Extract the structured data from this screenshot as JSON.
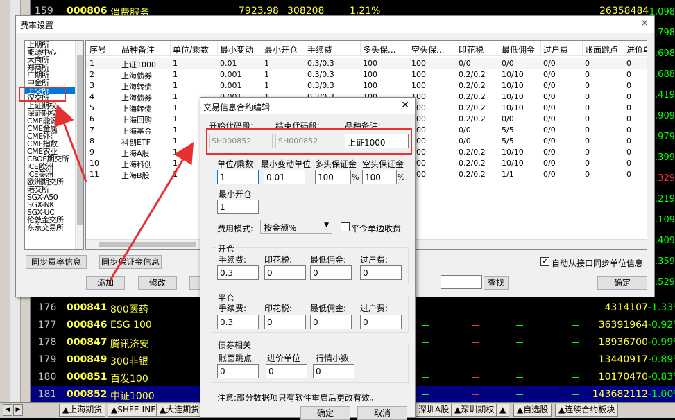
{
  "background_table": {
    "top_row": {
      "no": "159",
      "code": "000806",
      "name": "消费服务",
      "price": "7923.98",
      "vol": "308208",
      "pct": "1.21%",
      "right_vol": "26358484",
      "right_chg": "0.119"
    },
    "right_changes": [
      {
        "value": "1.098",
        "color": "green"
      },
      {
        "value": ".798",
        "color": "green"
      },
      {
        "value": "1.698",
        "color": "green"
      },
      {
        "value": "1.688",
        "color": "green"
      },
      {
        "value": ".419",
        "color": "green"
      },
      {
        "value": "1.909",
        "color": "green"
      },
      {
        "value": ".979",
        "color": "green"
      },
      {
        "value": ".399",
        "color": "green"
      },
      {
        "value": ".329",
        "color": "red"
      },
      {
        "value": ".219",
        "color": "green"
      },
      {
        "value": ".109",
        "color": "green"
      },
      {
        "value": ".409",
        "color": "green"
      },
      {
        "value": ".359",
        "color": "green"
      },
      {
        "value": ".529",
        "color": "green"
      }
    ],
    "rows": [
      {
        "no": "176",
        "code": "000841",
        "name": "800医药",
        "vol": "4314107",
        "chg": "-1.33%"
      },
      {
        "no": "177",
        "code": "000846",
        "name": "ESG 100",
        "vol": "36391964",
        "chg": "-0.92%"
      },
      {
        "no": "178",
        "code": "000847",
        "name": "腾讯济安",
        "vol": "18936700",
        "chg": "-0.99%"
      },
      {
        "no": "179",
        "code": "000849",
        "name": "300非银",
        "vol": "13440917",
        "chg": "-0.89%"
      },
      {
        "no": "180",
        "code": "000851",
        "name": "百发100",
        "vol": "10170470",
        "chg": "-0.83%"
      },
      {
        "no": "181",
        "code": "000852",
        "name": "中证1000",
        "vol": "143682112",
        "chg": "-1.00%"
      }
    ],
    "tabs": [
      "▲上海期货",
      "▲SHFE-INE",
      "▲大连期货",
      "深圳A股",
      "▲深圳期权",
      "▲",
      "▲自选股",
      "▲连续合约板块"
    ]
  },
  "fee_dialog": {
    "title": "费率设置",
    "exchanges": [
      "上期所",
      "能源中心",
      "大商所",
      "郑商所",
      "广期所",
      "中金所",
      "上交所",
      "深交所",
      "上证期权",
      "深证期权",
      "CME能源",
      "CME金属",
      "CME外汇",
      "CME指数",
      "CME农业",
      "CBOE期交所",
      "ICE欧洲",
      "ICE美洲",
      "欧洲期交所",
      "港交所",
      "SGX-A50",
      "SGX-NK",
      "SGX-UC",
      "伦敦金交所",
      "东京交易所"
    ],
    "selected_exchange": "上交所",
    "columns": [
      "序号",
      "品种备注",
      "单位/乘数",
      "最小变动",
      "最小开仓",
      "手续费",
      "多头保...",
      "空头保...",
      "印花税",
      "最低佣金",
      "过户费",
      "账面跳点",
      "进价单"
    ],
    "rows": [
      [
        "1",
        "上证1000",
        "1",
        "0.01",
        "1",
        "0.3/0.3",
        "100",
        "100",
        "0/0",
        "0/0",
        "0/0",
        "0",
        "0"
      ],
      [
        "2",
        "上海债券",
        "1",
        "0.001",
        "1",
        "0.3/0.3",
        "100",
        "100",
        "0.2/0.2",
        "10/10",
        "0/0",
        "0",
        "0"
      ],
      [
        "3",
        "上海转债",
        "1",
        "0.001",
        "1",
        "0.3/0.3",
        "100",
        "100",
        "0.2/0.2",
        "10/10",
        "0/0",
        "0",
        "0"
      ],
      [
        "4",
        "上海债券",
        "1",
        "0.001",
        "1",
        "0.3/0.3",
        "100",
        "100",
        "0.2/0.2",
        "10/10",
        "0/0",
        "0",
        "0"
      ],
      [
        "5",
        "上海转债",
        "1",
        "0.001",
        "1",
        "0.3/0.3",
        "100",
        "100",
        "0.2/0.2",
        "10/10",
        "0/0",
        "0",
        "0"
      ],
      [
        "6",
        "上海回购",
        "1",
        "0.001",
        "1",
        "0.3/0.3",
        "100",
        "100",
        "0.2/0.2",
        "0/0",
        "0/0",
        "0",
        "0"
      ],
      [
        "7",
        "上海基金",
        "1",
        "0.001",
        "1",
        "0.3/0.3",
        "100",
        "100",
        "0/0",
        "5/5",
        "0/0",
        "0",
        "0"
      ],
      [
        "8",
        "科创ETF",
        "1",
        "0.001",
        "1",
        "0.3/0.3",
        "100",
        "100",
        "0/0",
        "5/5",
        "0/0",
        "0",
        "0"
      ],
      [
        "9",
        "上海A股",
        "1",
        "0.01",
        "1",
        "0.3/0.3",
        "100",
        "100",
        "0.2/0.2",
        "10/10",
        "0/0",
        "0",
        "0"
      ],
      [
        "10",
        "上海科创",
        "1",
        "0.01",
        "1",
        "0.3/0.3",
        "100",
        "100",
        "0.2/0.2",
        "10/10",
        "0/0",
        "0",
        "0"
      ],
      [
        "11",
        "上海B股",
        "1",
        "0.001",
        "1",
        "0.3/0.3",
        "100",
        "100",
        "0.2/0.2",
        "1/1",
        "0/0",
        "0",
        "0"
      ]
    ],
    "btn_sync_fee": "同步费率信息",
    "btn_sync_margin": "同步保证金信息",
    "btn_add": "添加",
    "btn_edit": "修改",
    "btn_search": "查找",
    "btn_ok": "确定",
    "auto_sync_label": "自动从接口同步单位信息",
    "auto_sync_checked": true
  },
  "edit_dialog": {
    "title": "交易信息合约编辑",
    "label_start_code": "开始代码段:",
    "label_end_code": "结束代码段:",
    "label_remark": "品种备注:",
    "start_code": "SH000852",
    "end_code": "SH000852",
    "remark": "上证1000",
    "label_unit": "单位/乘数",
    "label_min_tick": "最小变动单位",
    "label_long_margin": "多头保证金",
    "label_short_margin": "空头保证金",
    "unit": "1",
    "min_tick": "0.01",
    "long_margin": "100",
    "short_margin": "100",
    "pct_sign": "%",
    "label_min_open": "最小开仓",
    "min_open": "1",
    "label_fee_mode": "费用模式:",
    "fee_mode": "按金额%",
    "label_close_today": "平今单边收费",
    "open_group": "开仓",
    "close_group": "平仓",
    "bond_group": "债券相关",
    "label_fee": "手续费:",
    "label_stamp": "印花税:",
    "label_min_comm": "最低佣金:",
    "label_transfer": "过户费:",
    "open_fee": "0.3",
    "open_stamp": "0",
    "open_min_comm": "0",
    "open_transfer": "0",
    "close_fee": "0.3",
    "close_stamp": "0",
    "close_min_comm": "0",
    "close_transfer": "0",
    "label_book_tick": "账面跳点",
    "label_price_unit": "进价单位",
    "label_quote_decimals": "行情小数",
    "book_tick": "0",
    "price_unit": "0",
    "quote_decimals": "0",
    "note": "注意:部分数据项只有软件重启后更改有效。",
    "btn_ok": "确定",
    "btn_cancel": "取消"
  },
  "colors": {
    "accent_red": "#e83030",
    "selection_blue": "#0078d7",
    "quote_yellow": "#ffff40",
    "quote_green": "#00ff00"
  }
}
